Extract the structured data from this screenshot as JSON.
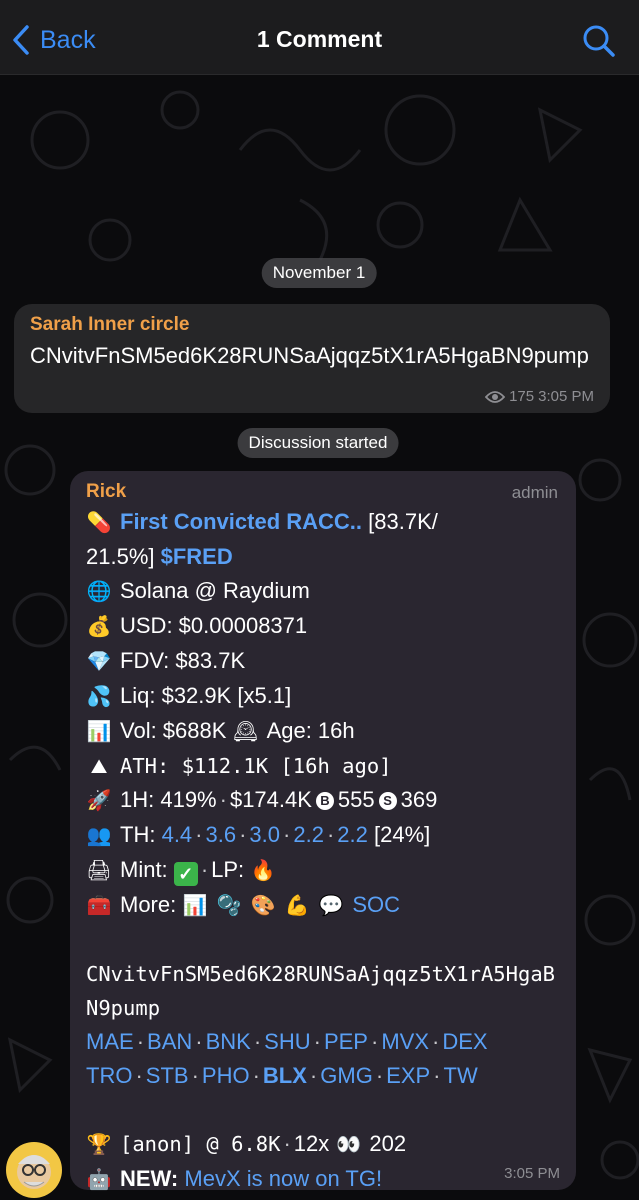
{
  "header": {
    "back_label": "Back",
    "title": "1 Comment"
  },
  "date_pill": "November 1",
  "discussion_pill": "Discussion started",
  "post": {
    "sender": "Sarah Inner circle",
    "text": "CNvitvFnSM5ed6K28RUNSaAjqqz5tX1rA5HgaBN9pump",
    "views": "175",
    "time": "3:05 PM"
  },
  "comment": {
    "sender": "Rick",
    "role": "admin",
    "time": "3:05 PM",
    "title_link": "First Convicted RACC..",
    "title_rest": "[83.7K/",
    "title_line2": "21.5%]",
    "ticker": "$FRED",
    "chain": "Solana @ Raydium",
    "usd": "USD: $0.00008371",
    "fdv": "FDV: $83.7K",
    "liq": "Liq: $32.9K [x5.1]",
    "vol": "Vol: $688K",
    "age": "Age: 16h",
    "ath": "ATH: $112.1K [16h ago]",
    "h1": "1H: 419%",
    "h1_vol": "$174.4K",
    "buys": "555",
    "sells": "369",
    "th_label": "TH:",
    "th_values": [
      "4.4",
      "3.6",
      "3.0",
      "2.2",
      "2.2"
    ],
    "th_total": "[24%]",
    "mint_label": "Mint:",
    "lp_label": "LP:",
    "more_label": "More:",
    "soc": "SOC",
    "ca": "CNvitvFnSM5ed6K28RUNSaAjqqz5tX1rA5HgaBN9pump",
    "links_row1": [
      "MAE",
      "BAN",
      "BNK",
      "SHU",
      "PEP",
      "MVX",
      "DEX"
    ],
    "links_row2": [
      "TRO",
      "STB",
      "PHO",
      "BLX",
      "GMG",
      "EXP",
      "TW"
    ],
    "anon": "[anon] @ 6.8K",
    "multiplier": "12x",
    "eyes": "202",
    "new_label": "NEW:",
    "new_link": "MevX is now on TG!"
  },
  "colors": {
    "accent": "#3b8cf5",
    "sender": "#f0a049",
    "link": "#5aa0f5",
    "bubble": "#262628"
  }
}
